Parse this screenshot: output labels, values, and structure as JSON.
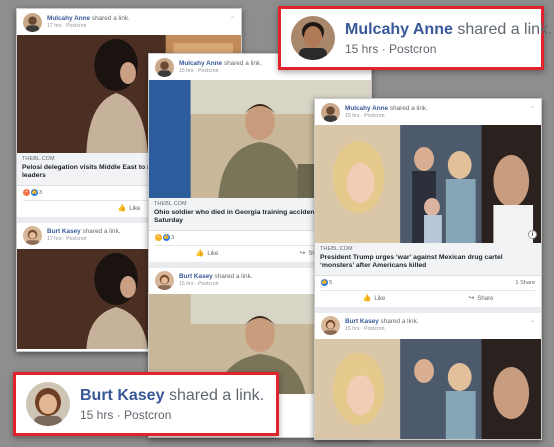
{
  "posts": [
    {
      "author": "Mulcahy Anne",
      "action": "shared a link.",
      "time": "17 hrs",
      "source": "Postcron",
      "domain": "THEBL.COM",
      "headline": "Pelosi delegation visits Middle East to negotiate with foreign leaders",
      "reaction_count": "3",
      "like_label": "Like"
    },
    {
      "author": "Burt Kasey",
      "action": "shared a link.",
      "time": "17 hrs",
      "source": "Postcron"
    },
    {
      "author": "Mulcahy Anne",
      "action": "shared a link.",
      "time": "15 hrs",
      "source": "Postcron",
      "domain": "THEBL.COM",
      "headline": "Ohio soldier who died in Georgia training accident laid to rest Saturday",
      "reaction_count": "3",
      "like_label": "Like",
      "share_label": "Share"
    },
    {
      "author": "Burt Kasey",
      "action": "shared a link.",
      "time": "15 hrs",
      "source": "Postcron"
    },
    {
      "author": "Mulcahy Anne",
      "action": "shared a link.",
      "time": "15 hrs",
      "source": "Postcron",
      "domain": "THEBL.COM",
      "headline": "President Trump urges ‘war’ against Mexican drug cartel ‘monsters’ after Americans killed",
      "reaction_count": "5",
      "share_count": "1 Share",
      "like_label": "Like",
      "share_label": "Share"
    },
    {
      "author": "Burt Kasey",
      "action": "shared a link.",
      "time": "15 hrs",
      "source": "Postcron"
    }
  ],
  "callouts": {
    "top": {
      "author": "Mulcahy Anne",
      "action": "shared a link.",
      "time": "15 hrs",
      "sep": "·",
      "source": "Postcron"
    },
    "bottom": {
      "author": "Burt Kasey",
      "action": "shared a link.",
      "time": "15 hrs",
      "sep": "·",
      "source": "Postcron"
    }
  },
  "sep": "·",
  "icons": {
    "like": "thumbs-up-icon",
    "share": "share-arrow-icon",
    "info": "info-icon",
    "menu": "chevron-down-icon"
  },
  "colors": {
    "name_link": "#385898",
    "callout_border": "#e0232c",
    "like_blue": "#2078f4",
    "angry": "#f7714b",
    "haha": "#f7b125"
  }
}
